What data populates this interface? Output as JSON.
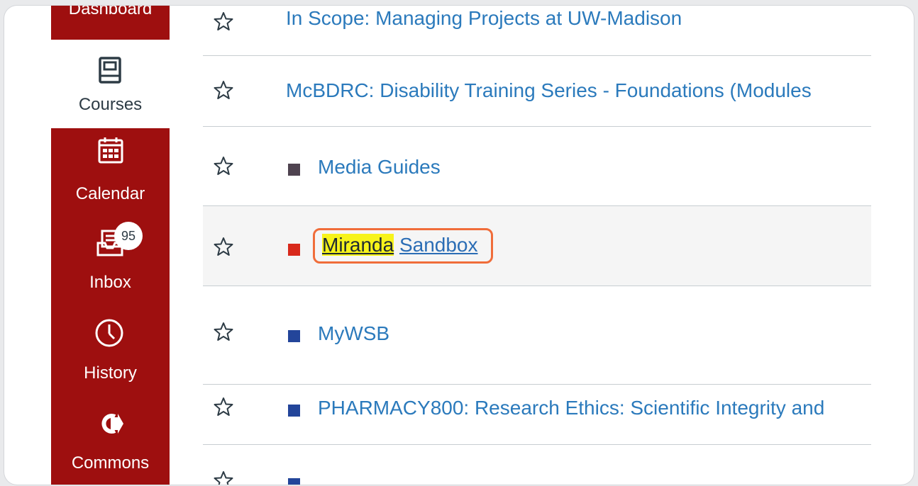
{
  "sidebar": {
    "dashboard": {
      "label": "Dashboard"
    },
    "courses": {
      "label": "Courses"
    },
    "calendar": {
      "label": "Calendar"
    },
    "inbox": {
      "label": "Inbox",
      "badge": "95"
    },
    "history": {
      "label": "History"
    },
    "commons": {
      "label": "Commons"
    },
    "colors": {
      "background": "#9e0f0f",
      "active_background": "#ffffff"
    }
  },
  "courses": [
    {
      "title": "In Scope: Managing Projects at UW-Madison",
      "swatch_color": null
    },
    {
      "title": "McBDRC: Disability Training Series - Foundations (Modules",
      "swatch_color": null
    },
    {
      "title": "Media Guides",
      "swatch_color": "#4f4350"
    },
    {
      "title_highlight": "Miranda",
      "title_rest": "Sandbox",
      "swatch_color": "#d8291b",
      "focused": true
    },
    {
      "title": "MyWSB",
      "swatch_color": "#23459a"
    },
    {
      "title": "PHARMACY800: Research Ethics: Scientific Integrity and",
      "swatch_color": "#23459a"
    }
  ],
  "icons": {
    "star": "star-outline-icon"
  },
  "colors": {
    "link": "#2b7abc",
    "highlight": "#f7f31a",
    "focus_ring": "#f06d3a"
  }
}
